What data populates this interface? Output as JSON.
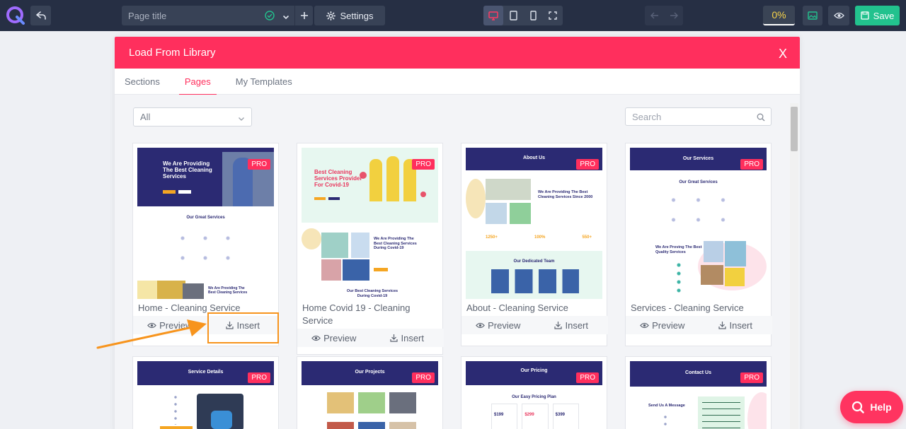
{
  "toolbar": {
    "page_title_placeholder": "Page title",
    "settings_label": "Settings",
    "progress_label": "0%",
    "save_label": "Save",
    "devices": [
      "desktop-icon",
      "tablet-icon",
      "mobile-icon",
      "fullscreen-icon"
    ]
  },
  "modal": {
    "title": "Load From Library",
    "close_label": "X",
    "tabs": [
      {
        "label": "Sections",
        "active": false
      },
      {
        "label": "Pages",
        "active": true
      },
      {
        "label": "My Templates",
        "active": false
      }
    ],
    "filter_value": "All",
    "search_placeholder": "Search",
    "preview_label": "Preview",
    "insert_label": "Insert",
    "pro_badge": "PRO",
    "cards": [
      {
        "name": "Home - Cleaning Service",
        "hero_title": "We Are Providing The Best Cleaning Services",
        "section_title": "Our Great Services",
        "section2_title": "We Are Providing The Best Cleaning Services"
      },
      {
        "name": "Home Covid 19 - Cleaning Service",
        "hero_title": "Best Cleaning Services Provider For Covid-19",
        "section_title": "We Are Providing The Best Cleaning Services During Covid-19",
        "section2_title": "Our Best Cleaning Services During Covid-19"
      },
      {
        "name": "About - Cleaning Service",
        "hero_title": "About Us",
        "section_title": "We Are Providing The Best Cleaning Services Since 2000",
        "stats": [
          "1250+",
          "100%",
          "550+"
        ],
        "section2_title": "Our Dedicated Team"
      },
      {
        "name": "Services - Cleaning Service",
        "hero_title": "Our Services",
        "section_title": "Our Great Services",
        "section2_title": "We Are Proving The Best Quality Services"
      },
      {
        "name": "",
        "hero_title": "Service Details"
      },
      {
        "name": "",
        "hero_title": "Our Projects"
      },
      {
        "name": "",
        "hero_title": "Our Pricing",
        "section_title": "Our Easy Pricing Plan",
        "prices": [
          "$199",
          "$299",
          "$399"
        ]
      },
      {
        "name": "",
        "hero_title": "Contact Us",
        "section_title": "Send Us A Message"
      }
    ]
  },
  "help_label": "Help",
  "colors": {
    "toolbar": "#262f44",
    "accent": "#ff2f5d",
    "save": "#22c28e",
    "hero_navy": "#2b2a73",
    "highlight": "#f7941d"
  }
}
